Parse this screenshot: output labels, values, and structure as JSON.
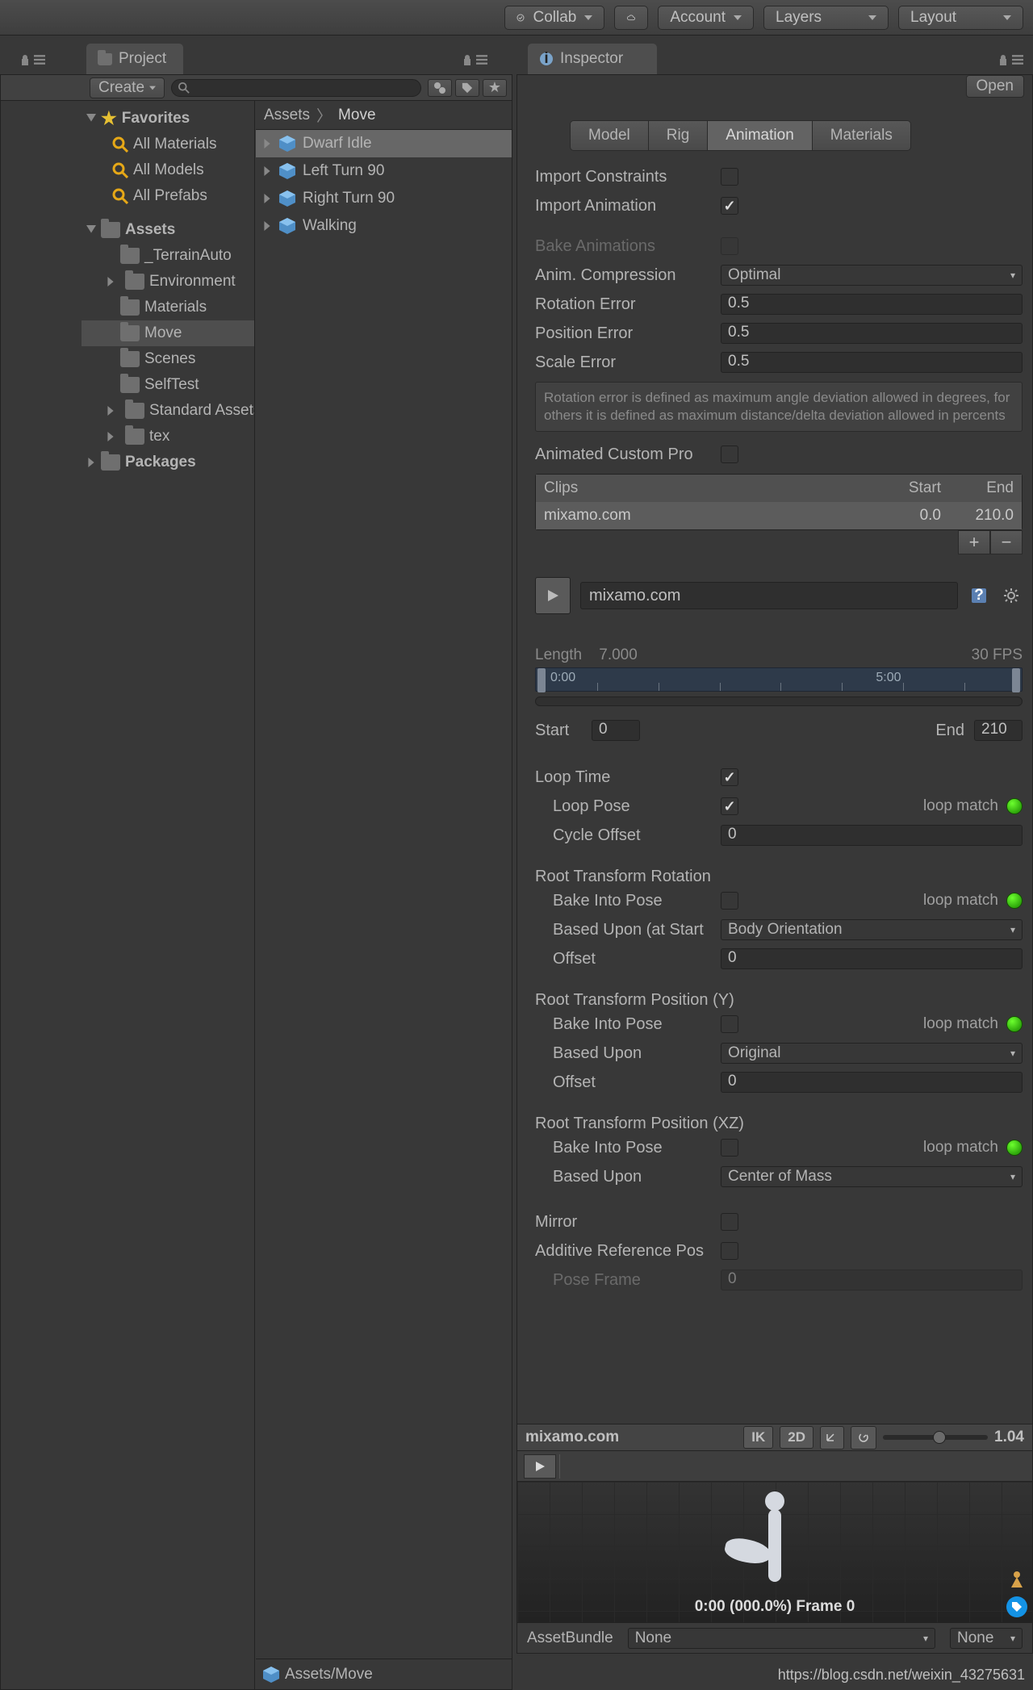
{
  "toolbar": {
    "collab": "Collab",
    "account": "Account",
    "layers": "Layers",
    "layout": "Layout"
  },
  "tabs": {
    "project": "Project",
    "inspector": "Inspector"
  },
  "project": {
    "create": "Create",
    "favorites": "Favorites",
    "fav_items": [
      "All Materials",
      "All Models",
      "All Prefabs"
    ],
    "assets": "Assets",
    "folders": [
      "_TerrainAuto",
      "Environment",
      "Materials",
      "Move",
      "Scenes",
      "SelfTest",
      "Standard Assets",
      "tex"
    ],
    "packages": "Packages",
    "breadcrumb": {
      "root": "Assets",
      "current": "Move"
    },
    "list": [
      "Dwarf Idle",
      "Left Turn 90",
      "Right Turn 90",
      "Walking"
    ],
    "footer": "Assets/Move"
  },
  "inspector": {
    "open": "Open",
    "tabs": [
      "Model",
      "Rig",
      "Animation",
      "Materials"
    ],
    "active_tab": "Animation",
    "import_constraints": "Import Constraints",
    "import_animation": "Import Animation",
    "bake_anim": "Bake Animations",
    "anim_compression": "Anim. Compression",
    "anim_compression_val": "Optimal",
    "rotation_error": "Rotation Error",
    "rotation_error_val": "0.5",
    "position_error": "Position Error",
    "position_error_val": "0.5",
    "scale_error": "Scale Error",
    "scale_error_val": "0.5",
    "help": "Rotation error is defined as maximum angle deviation allowed in degrees, for others it is defined as maximum distance/delta deviation allowed in percents",
    "animated_custom": "Animated Custom Pro",
    "clips": {
      "head_clips": "Clips",
      "head_start": "Start",
      "head_end": "End",
      "name": "mixamo.com",
      "start": "0.0",
      "end": "210.0"
    },
    "clip_name": "mixamo.com",
    "length_lbl": "Length",
    "length_val": "7.000",
    "fps": "30 FPS",
    "tl_labels": [
      "0:00",
      "5:00"
    ],
    "start_lbl": "Start",
    "start_val": "0",
    "end_lbl": "End",
    "end_val": "210",
    "loop_time": "Loop Time",
    "loop_pose": "Loop Pose",
    "cycle_offset": "Cycle Offset",
    "cycle_offset_val": "0",
    "loop_match": "loop match",
    "rt_rot": "Root Transform Rotation",
    "bake_into_pose": "Bake Into Pose",
    "based_upon_start": "Based Upon (at Start",
    "body_orientation": "Body Orientation",
    "offset": "Offset",
    "offset_val": "0",
    "rt_pos_y": "Root Transform Position (Y)",
    "based_upon": "Based Upon",
    "original": "Original",
    "rt_pos_xz": "Root Transform Position (XZ)",
    "center_of_mass": "Center of Mass",
    "mirror": "Mirror",
    "additive_ref": "Additive Reference Pos",
    "pose_frame": "Pose Frame",
    "pose_frame_val": "0",
    "preview": {
      "name": "mixamo.com",
      "ik": "IK",
      "twod": "2D",
      "speed": "1.04",
      "frame": "0:00 (000.0%) Frame 0"
    },
    "assetbundle": "AssetBundle",
    "none": "None"
  },
  "watermark": "https://blog.csdn.net/weixin_43275631"
}
